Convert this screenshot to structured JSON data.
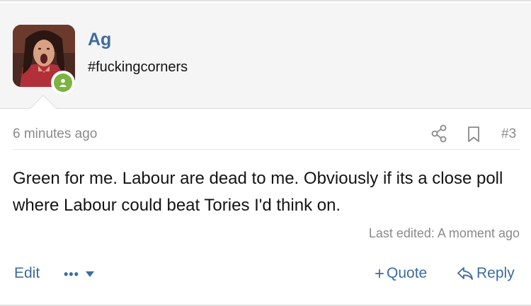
{
  "user": {
    "name": "Ag",
    "title": "#fuckingcorners",
    "avatar_icon": "avatar-image",
    "status": "online"
  },
  "post": {
    "timestamp": "6 minutes ago",
    "number": "#3",
    "message": "Green for me. Labour are dead to me. Obviously if its a close poll where Labour could beat Tories I'd think on.",
    "last_edited": "Last edited: A moment ago"
  },
  "actions": {
    "edit_label": "Edit",
    "more_label": "•••",
    "quote_label": "Quote",
    "reply_label": "Reply"
  },
  "colors": {
    "link": "#3d6c9e",
    "muted": "#8a8a8a",
    "online": "#7cb342",
    "header_bg": "#f5f5f5"
  },
  "icons": {
    "share": "share-icon",
    "bookmark": "bookmark-icon",
    "more": "ellipsis-icon",
    "chevron": "chevron-down-icon",
    "reply": "reply-arrow-icon",
    "quote": "plus-icon"
  }
}
